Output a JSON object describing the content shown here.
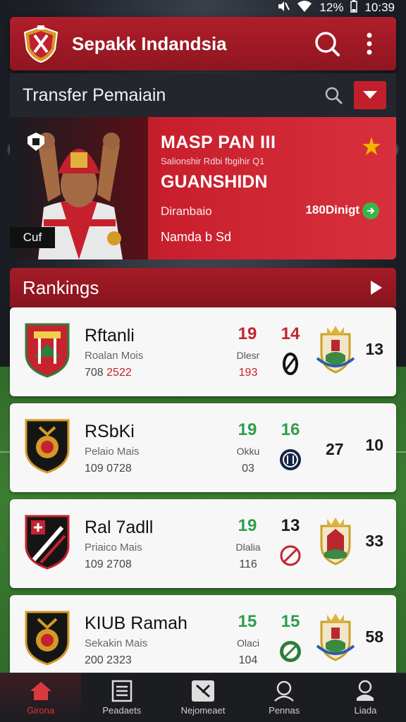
{
  "status_bar": {
    "battery": "12%",
    "time": "10:39"
  },
  "app_bar": {
    "title": "Sepakk Indandsia"
  },
  "transfer": {
    "title": "Transfer Pemaiain",
    "player_tag": "Cuf",
    "player_name": "MASP PAN III",
    "player_sub": "Salionshir Rdbi fbgihir Q1",
    "club": "GUANSHIDN",
    "fee_label": "Diranbaio",
    "fee_value": "180Dinigt",
    "status": "Namda b Sd"
  },
  "rankings": {
    "title": "Rankings",
    "rows": [
      {
        "name": "Rftanli",
        "sub": "Roalan Mois",
        "date_a": "708 ",
        "date_b": "2522",
        "stat_a": "19",
        "stat_a_color": "#c4232f",
        "stat_a_sub": "Dlesr",
        "stat_a_sub2": "193",
        "stat_a_sub2_color": "#c4232f",
        "stat_b": "14",
        "stat_b_color": "#c4232f",
        "mini": "0",
        "stat_c": "13",
        "stat_d": ""
      },
      {
        "name": "RSbKi",
        "sub": "Pelaio Mais",
        "date_a": "109 ",
        "date_b": "0728",
        "stat_a": "19",
        "stat_a_color": "#2e9e4a",
        "stat_a_sub": "Okku",
        "stat_a_sub2": "03",
        "stat_a_sub2_color": "#444444",
        "stat_b": "16",
        "stat_b_color": "#2e9e4a",
        "mini": "",
        "stat_c": "10",
        "stat_d": "27"
      },
      {
        "name": "Ral 7adll",
        "sub": "Priaico Mais",
        "date_a": "109 ",
        "date_b": "2708",
        "stat_a": "19",
        "stat_a_color": "#2e9e4a",
        "stat_a_sub": "Dlalia",
        "stat_a_sub2": "116",
        "stat_a_sub2_color": "#444444",
        "stat_b": "13",
        "stat_b_color": "#1a1a1a",
        "mini": "",
        "stat_c": "33",
        "stat_d": ""
      },
      {
        "name": "KIUB Ramah",
        "sub": "Sekakin Mais",
        "date_a": "200 ",
        "date_b": "2323",
        "stat_a": "15",
        "stat_a_color": "#2e9e4a",
        "stat_a_sub": "Olaci",
        "stat_a_sub2": "104",
        "stat_a_sub2_color": "#444444",
        "stat_b": "15",
        "stat_b_color": "#2e9e4a",
        "mini": "",
        "stat_c": "58",
        "stat_d": ""
      }
    ]
  },
  "bottom_nav": [
    {
      "label": "Girona",
      "icon": "home-icon",
      "active": true
    },
    {
      "label": "Peadaets",
      "icon": "news-icon",
      "active": false
    },
    {
      "label": "Nejomeaet",
      "icon": "match-icon",
      "active": false
    },
    {
      "label": "Pennas",
      "icon": "team-icon",
      "active": false
    },
    {
      "label": "Liada",
      "icon": "profile-icon",
      "active": false
    }
  ],
  "colors": {
    "primary": "#b01e2a",
    "accent_green": "#2e9e4a",
    "card_bg": "#f7f7f7",
    "nav_bg": "#1c1d21"
  }
}
